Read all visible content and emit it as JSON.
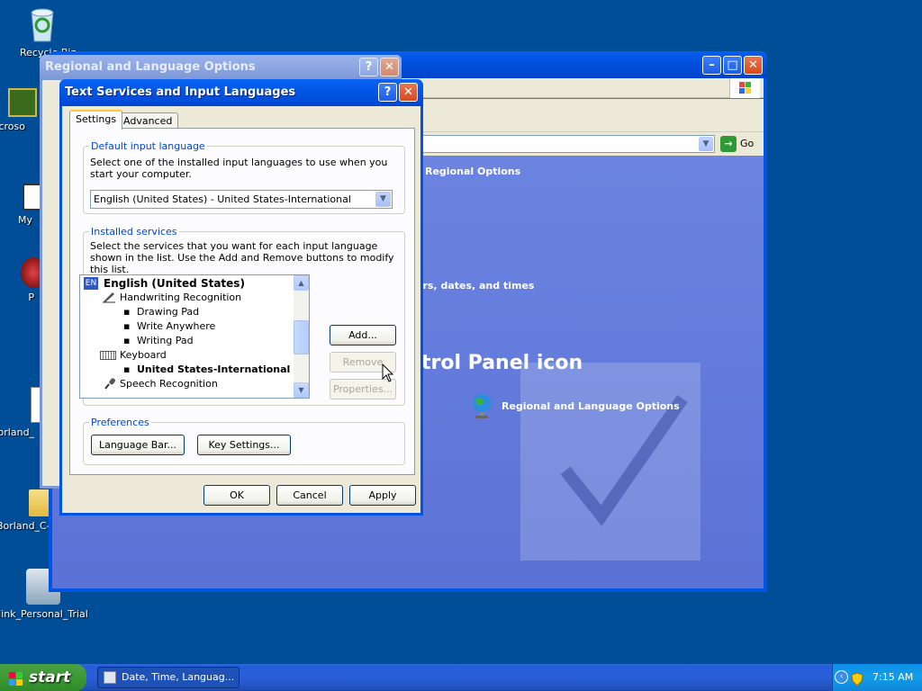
{
  "desktop": {
    "icons": [
      {
        "name": "recycle-bin",
        "label": "Recycle Bin"
      },
      {
        "name": "microsoft-app",
        "label": "Microso"
      },
      {
        "name": "my-shortcut",
        "label": "My"
      },
      {
        "name": "p-shortcut",
        "label": "P"
      },
      {
        "name": "borland-shortcut",
        "label": "Borland_"
      },
      {
        "name": "borland-folder",
        "label": "Borland_C-"
      },
      {
        "name": "personal-trial",
        "label": "link_Personal_Trial"
      }
    ]
  },
  "control_panel": {
    "go_label": "Go",
    "regional_options": "Regional Options",
    "numbers_dates": "ers, dates, and times",
    "panel_icon_heading": "trol Panel icon",
    "rlo_link": "Regional and Language Options"
  },
  "rlo_dialog": {
    "title": "Regional and Language Options"
  },
  "ts_dialog": {
    "title": "Text Services and Input Languages",
    "tabs": [
      "Settings",
      "Advanced"
    ],
    "default_group": {
      "legend": "Default input language",
      "desc": "Select one of the installed input languages to use when you start your computer.",
      "selected": "English (United States) - United States-International"
    },
    "installed_group": {
      "legend": "Installed services",
      "desc": "Select the services that you want for each input language shown in the list. Use the Add and Remove buttons to modify this list.",
      "lang_badge": "EN",
      "items": [
        "English (United States)",
        "Handwriting Recognition",
        "Drawing Pad",
        "Write Anywhere",
        "Writing Pad",
        "Keyboard",
        "United States-International",
        "Speech Recognition"
      ],
      "add": "Add...",
      "remove": "Remove",
      "properties": "Properties..."
    },
    "preferences": {
      "legend": "Preferences",
      "language_bar": "Language Bar...",
      "key_settings": "Key Settings..."
    },
    "ok": "OK",
    "cancel": "Cancel",
    "apply": "Apply"
  },
  "taskbar": {
    "start": "start",
    "task": "Date, Time, Languag...",
    "clock": "7:15 AM"
  }
}
